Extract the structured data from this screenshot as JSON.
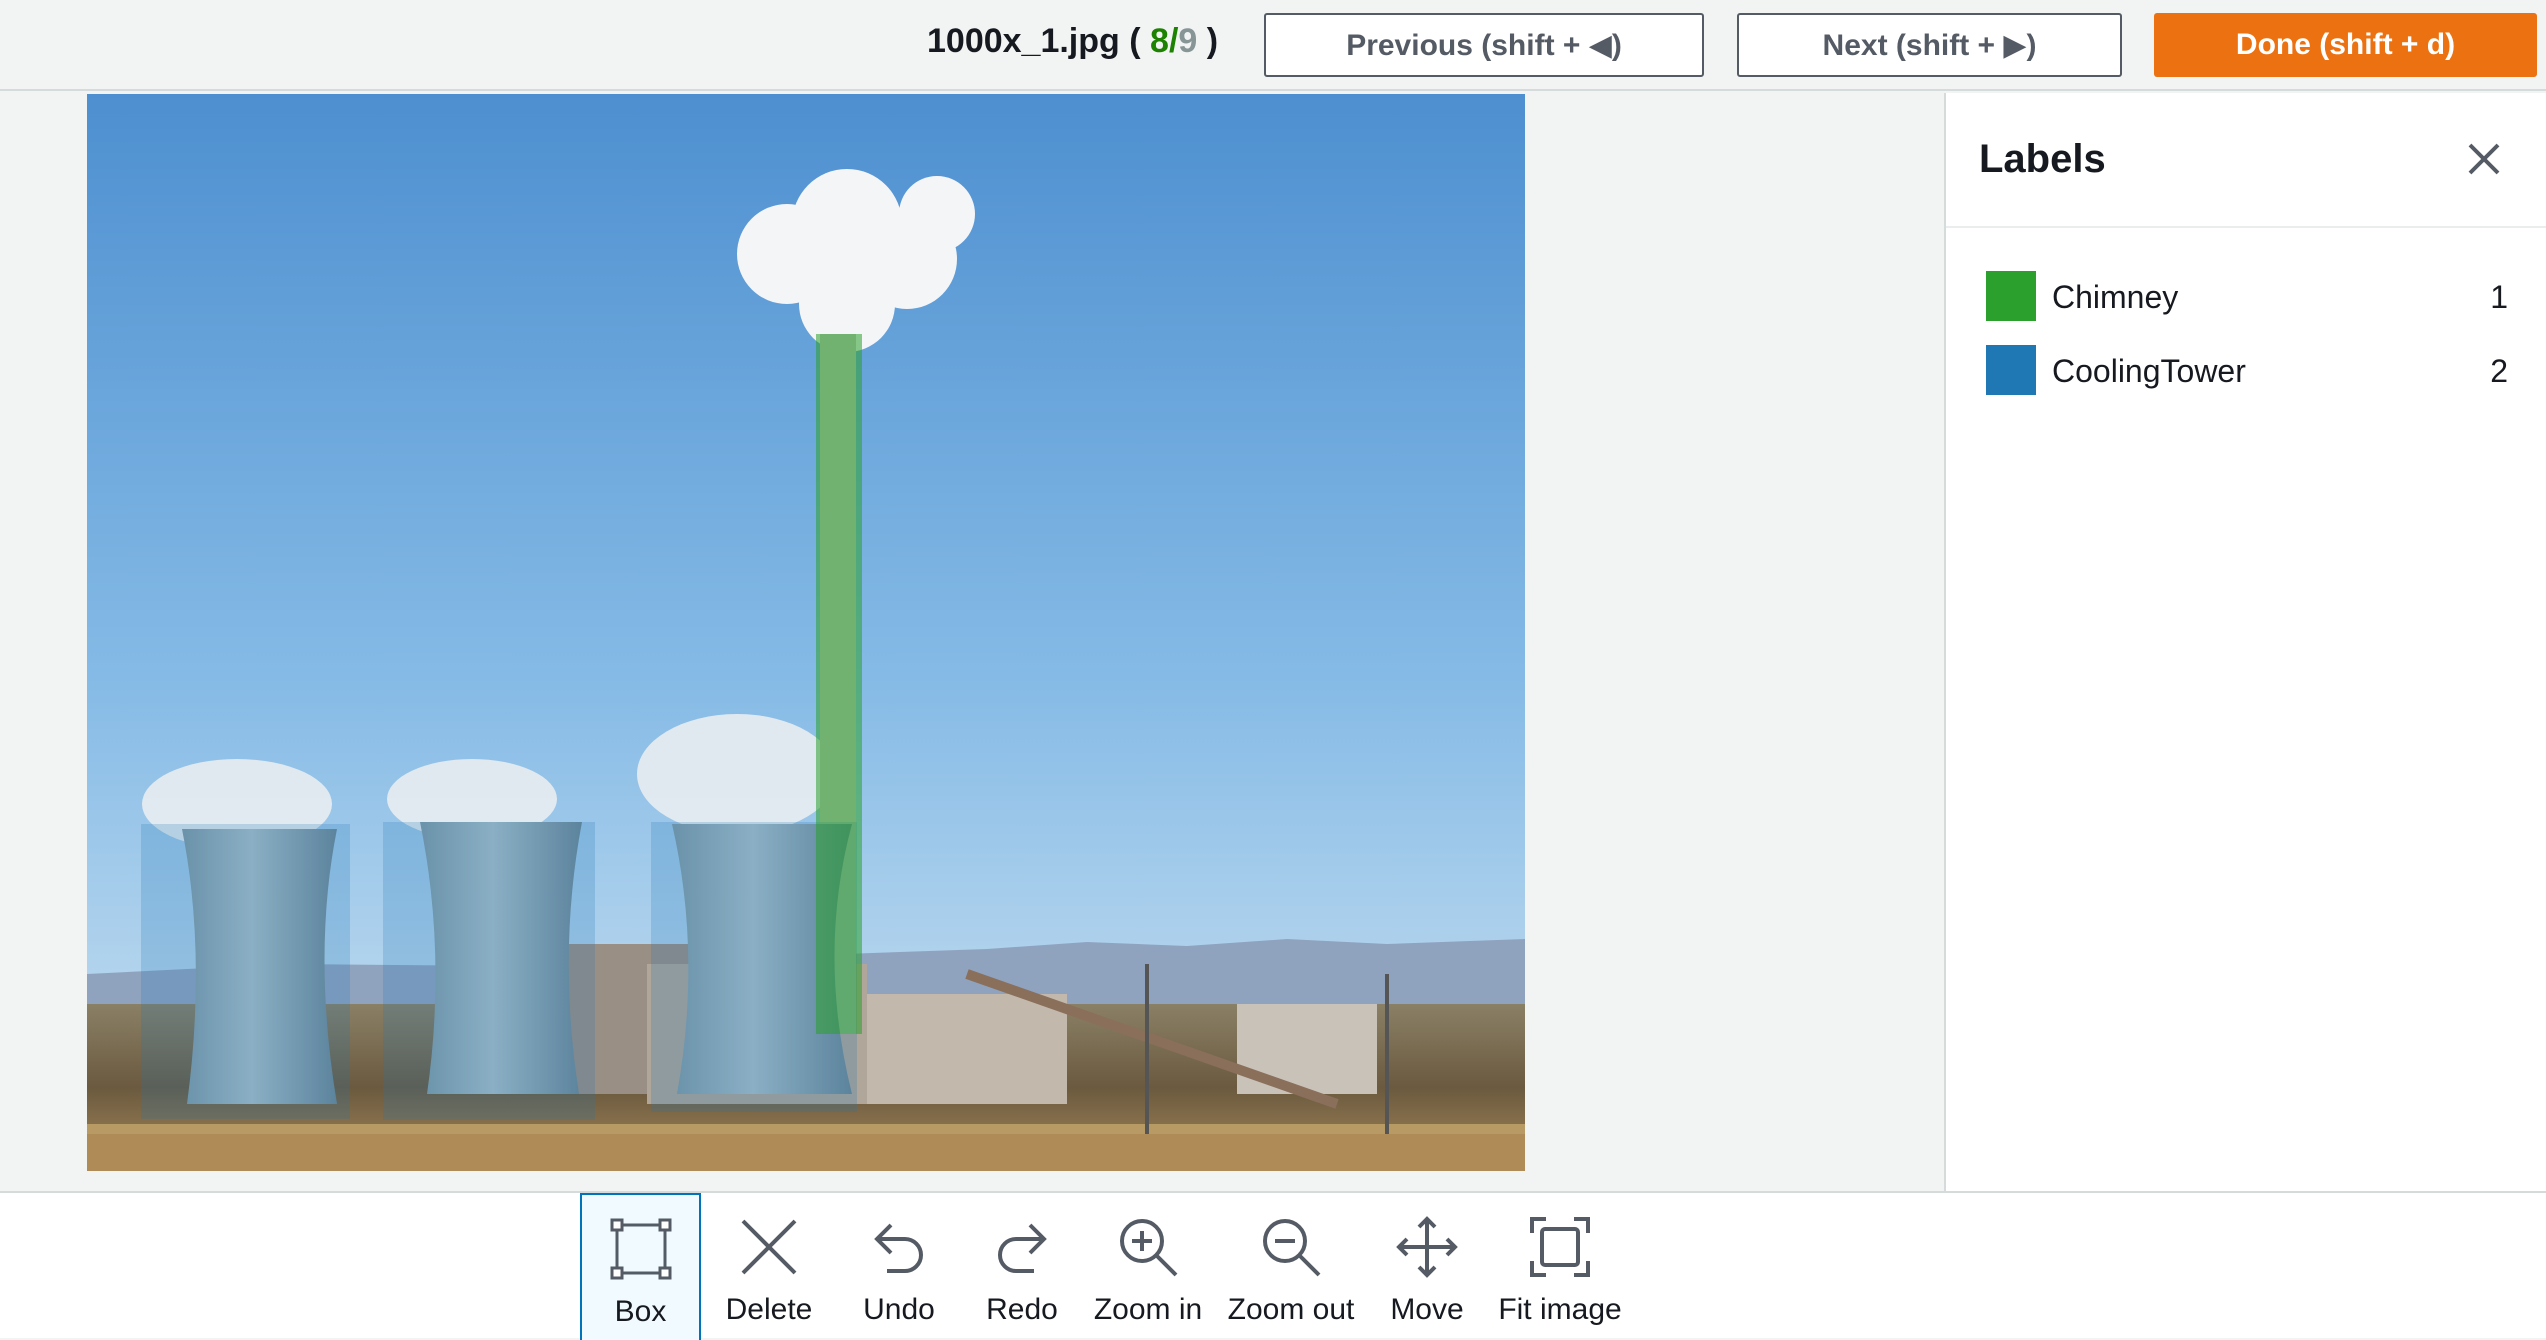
{
  "header": {
    "filename": "1000x_1.jpg",
    "paren_open": "(",
    "current_index": "8",
    "slash": "/",
    "total": "9",
    "paren_close": ")",
    "previous_label": "Previous (shift + ◀)",
    "next_label": "Next (shift + ▶)",
    "done_label": "Done (shift + d)"
  },
  "labels_panel": {
    "title": "Labels",
    "close_icon": "close-icon",
    "items": [
      {
        "name": "Chimney",
        "count": "1",
        "color": "#2ca02c"
      },
      {
        "name": "CoolingTower",
        "count": "2",
        "color": "#1f77b4"
      }
    ]
  },
  "annotations": {
    "chimney_color": "#2ca02c",
    "cooling_tower_color": "#1f77b4"
  },
  "toolbar": {
    "active_tool": "Box",
    "tools": [
      {
        "label": "Box",
        "icon": "box-select-icon"
      },
      {
        "label": "Delete",
        "icon": "delete-x-icon"
      },
      {
        "label": "Undo",
        "icon": "undo-icon"
      },
      {
        "label": "Redo",
        "icon": "redo-icon"
      },
      {
        "label": "Zoom in",
        "icon": "zoom-in-icon"
      },
      {
        "label": "Zoom out",
        "icon": "zoom-out-icon"
      },
      {
        "label": "Move",
        "icon": "move-icon"
      },
      {
        "label": "Fit image",
        "icon": "fit-image-icon"
      }
    ]
  },
  "colors": {
    "accent_orange": "#ec7211",
    "progress_green": "#1d8102",
    "active_tool_blue": "#0073bb"
  }
}
